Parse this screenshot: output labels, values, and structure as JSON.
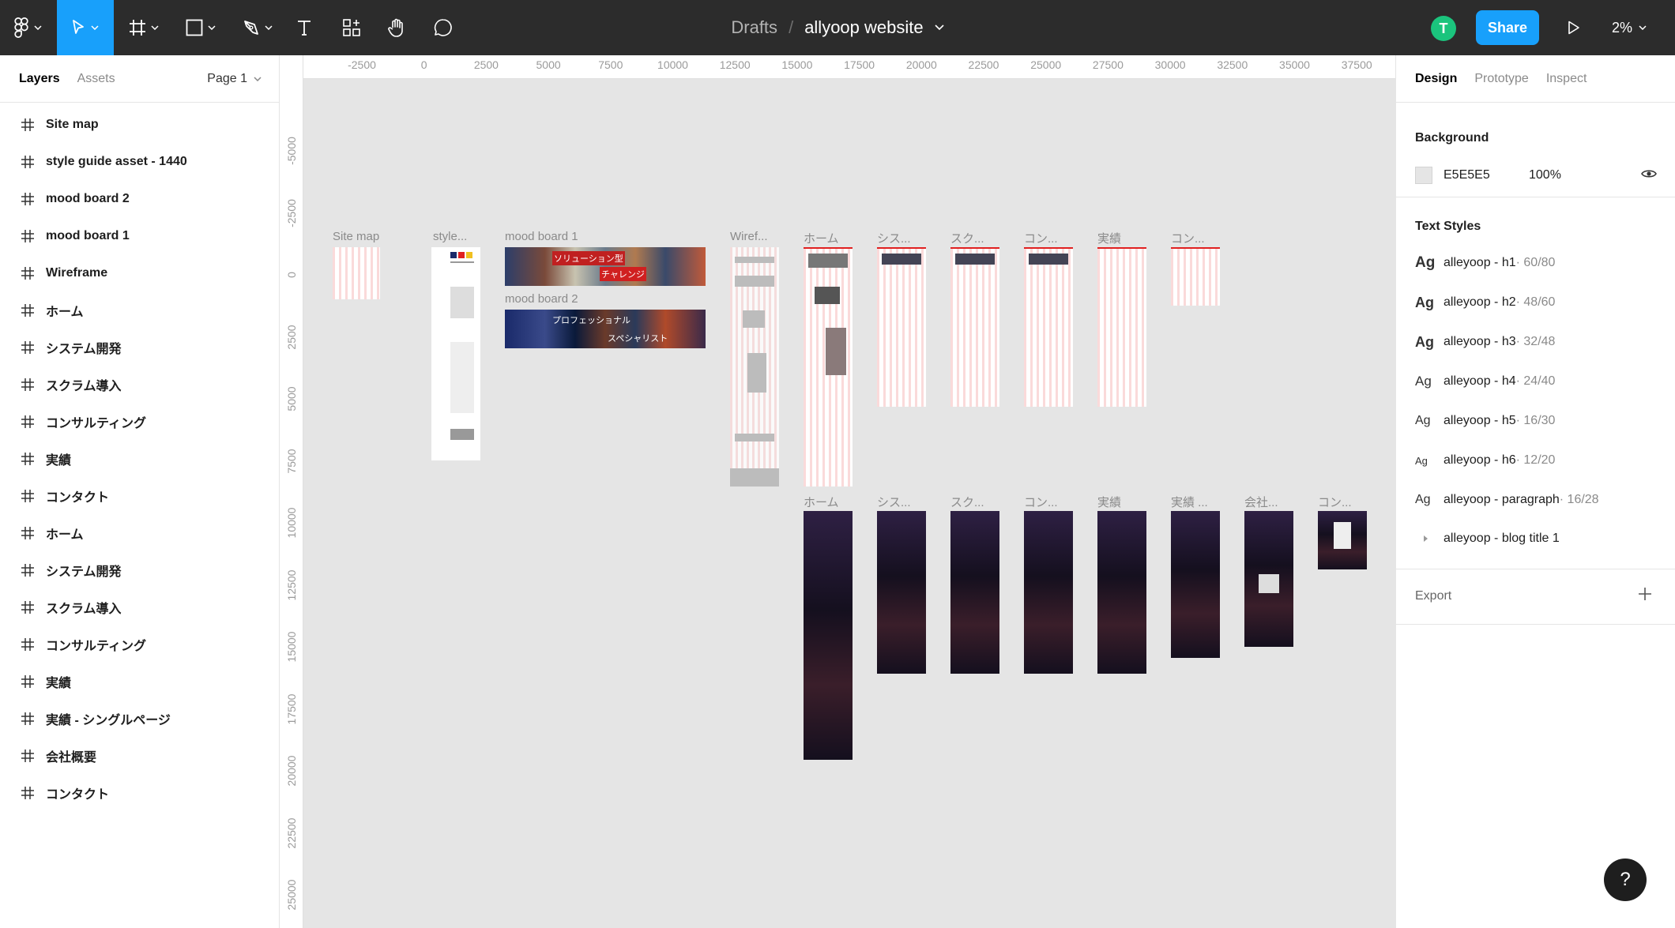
{
  "toolbar": {
    "breadcrumb_root": "Drafts",
    "breadcrumb_sep": "/",
    "file_name": "allyoop website",
    "avatar_initial": "T",
    "share_label": "Share",
    "zoom_label": "2%",
    "accent": "#18a0fb"
  },
  "left_panel": {
    "tabs": [
      "Layers",
      "Assets"
    ],
    "page_label": "Page 1",
    "layers": [
      "Site map",
      "style guide asset - 1440",
      "mood board 2",
      "mood board 1",
      "Wireframe",
      "ホーム",
      "システム開発",
      "スクラム導入",
      "コンサルティング",
      "実績",
      "コンタクト",
      "ホーム",
      "システム開発",
      "スクラム導入",
      "コンサルティング",
      "実績",
      "実績 - シングルページ",
      "会社概要",
      "コンタクト"
    ]
  },
  "canvas": {
    "background": "#e5e5e5",
    "ruler_top": [
      "-2500",
      "0",
      "2500",
      "5000",
      "7500",
      "10000",
      "12500",
      "15000",
      "17500",
      "20000",
      "22500",
      "25000",
      "27500",
      "30000",
      "32500",
      "35000",
      "37500"
    ],
    "ruler_left": [
      "-5000",
      "-2500",
      "0",
      "2500",
      "5000",
      "7500",
      "10000",
      "12500",
      "15000",
      "17500",
      "20000",
      "22500",
      "25000"
    ],
    "frame_labels": {
      "sitemap": "Site map",
      "style": "style...",
      "mood1": "mood board 1",
      "mood2": "mood board 2",
      "wire": "Wiref...",
      "home_l": "ホーム",
      "sys_l": "シス...",
      "scrum_l": "スク...",
      "con_l": "コン...",
      "jiss_l": "実績",
      "contact_l": "コン...",
      "home_d": "ホーム",
      "sys_d": "シス...",
      "scrum_d": "スク...",
      "con_d": "コン...",
      "jiss_d": "実績",
      "jiss_single_d": "実績 ...",
      "company_d": "会社...",
      "contact_d": "コン..."
    },
    "mood1_caption": "ソリューション型",
    "mood1_caption2": "チャレンジ",
    "mood2_caption": "プロフェッショナル",
    "mood2_caption2": "スペシャリスト"
  },
  "right_panel": {
    "tabs": [
      "Design",
      "Prototype",
      "Inspect"
    ],
    "background_title": "Background",
    "bg_hex": "E5E5E5",
    "bg_opacity": "100%",
    "text_styles_title": "Text Styles",
    "text_styles": [
      {
        "ag": "Ag",
        "name": "alleyoop - h1",
        "meta": " · 60/80"
      },
      {
        "ag": "Ag",
        "name": "alleyoop - h2",
        "meta": " · 48/60"
      },
      {
        "ag": "Ag",
        "name": "alleyoop - h3",
        "meta": " · 32/48"
      },
      {
        "ag": "Ag",
        "name": "alleyoop - h4",
        "meta": " · 24/40"
      },
      {
        "ag": "Ag",
        "name": "alleyoop - h5",
        "meta": " · 16/30"
      },
      {
        "ag": "Ag",
        "name": "alleyoop - h6",
        "meta": " · 12/20"
      },
      {
        "ag": "Ag",
        "name": "alleyoop - paragraph",
        "meta": " · 16/28"
      }
    ],
    "blog_title_style": "alleyoop - blog title 1",
    "export_label": "Export",
    "help": "?"
  }
}
